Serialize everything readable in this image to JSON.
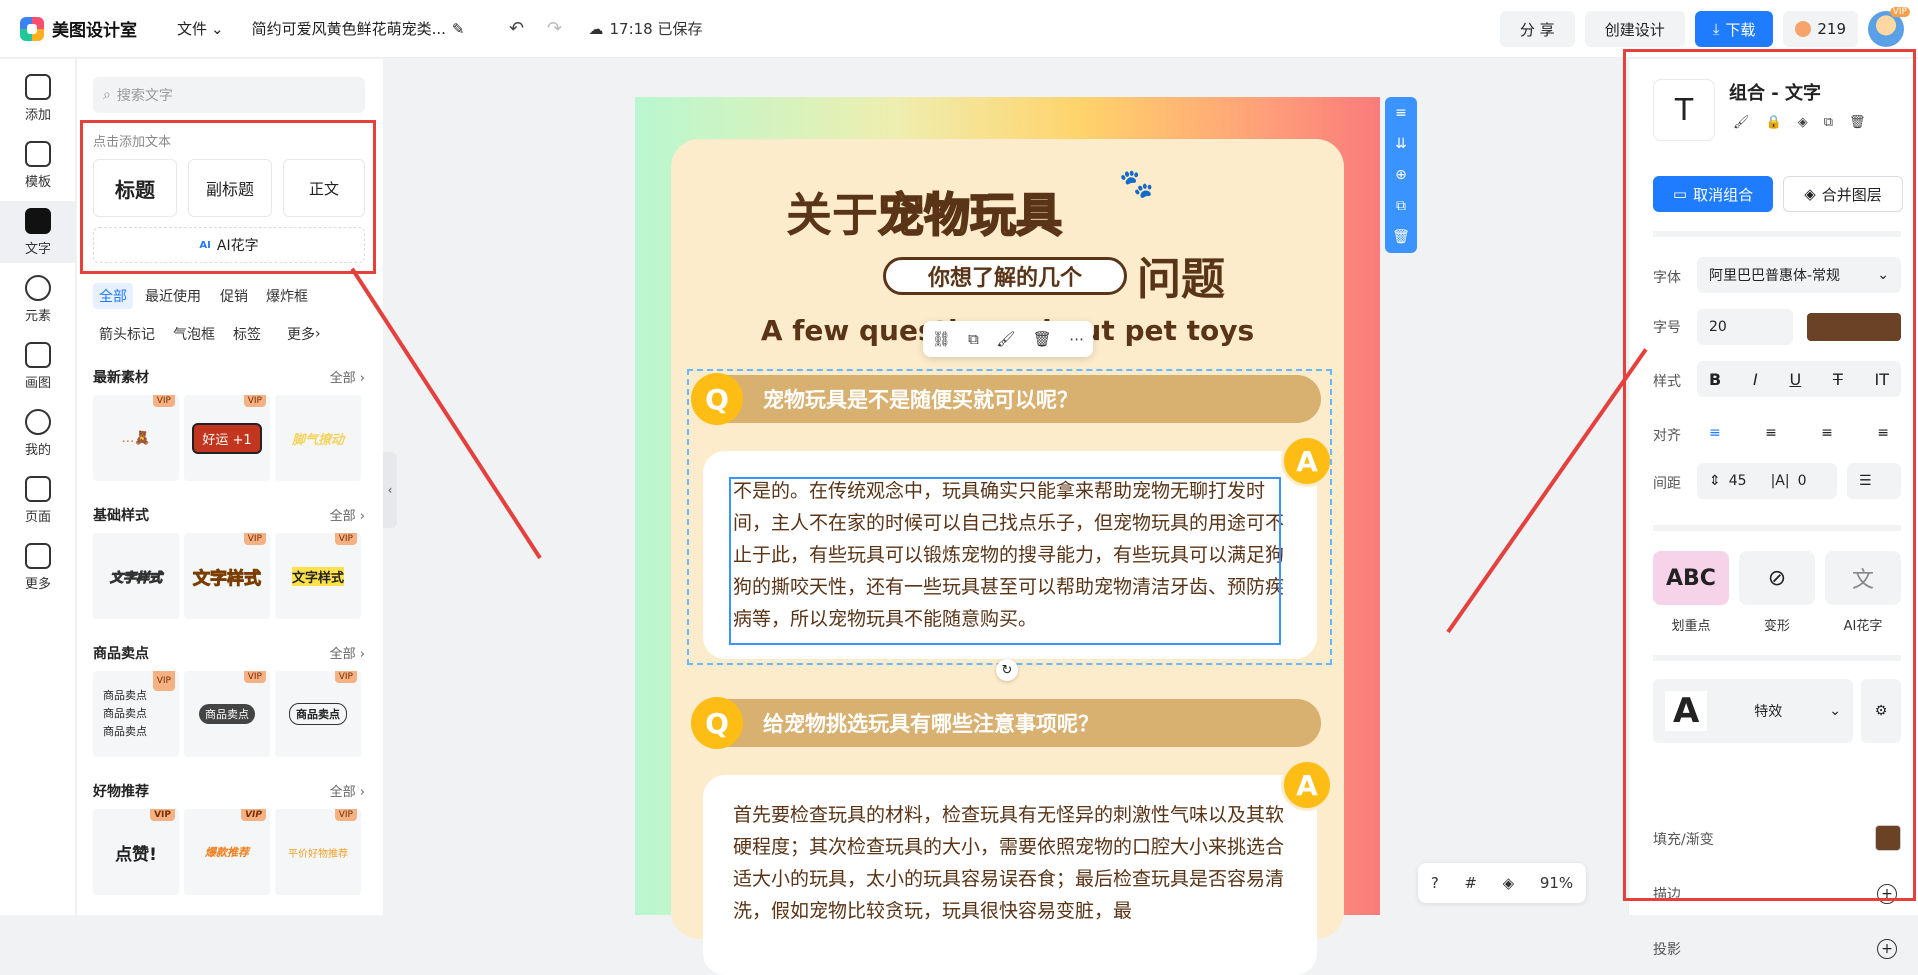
{
  "app": {
    "name": "美图设计室"
  },
  "topbar": {
    "file_menu": "文件",
    "doc_title": "简约可爱风黄色鲜花萌宠类...",
    "save_time": "17:18 已保存",
    "share": "分 享",
    "create": "创建设计",
    "download": "下载",
    "coins": "219",
    "vip": "VIP"
  },
  "rail": [
    {
      "label": "添加",
      "icon": "plus-icon"
    },
    {
      "label": "模板",
      "icon": "template-icon"
    },
    {
      "label": "文字",
      "icon": "text-icon"
    },
    {
      "label": "元素",
      "icon": "element-icon"
    },
    {
      "label": "画图",
      "icon": "draw-icon"
    },
    {
      "label": "我的",
      "icon": "user-icon"
    },
    {
      "label": "页面",
      "icon": "page-icon"
    },
    {
      "label": "更多",
      "icon": "more-icon"
    }
  ],
  "panel": {
    "search_placeholder": "搜索文字",
    "hint": "点击添加文本",
    "title_card": "标题",
    "subtitle_card": "副标题",
    "body_card": "正文",
    "ai_tag": "AI",
    "ai_card": "AI花字",
    "chips": [
      "全部",
      "最近使用",
      "促销",
      "爆炸框",
      "箭头标记",
      "气泡框",
      "标签",
      "更多"
    ],
    "sections": [
      {
        "title": "最新素材",
        "all": "全部",
        "tiles": [
          "",
          "好运 +1",
          "脚气撩动"
        ]
      },
      {
        "title": "基础样式",
        "all": "全部",
        "tiles": [
          "文字样式",
          "文字样式",
          "文字样式"
        ]
      },
      {
        "title": "商品卖点",
        "all": "全部",
        "tiles": [
          "商品卖点\n商品卖点\n商品卖点",
          "商品卖点",
          "商品卖点"
        ]
      },
      {
        "title": "好物推荐",
        "all": "全部",
        "tiles": [
          "点赞!",
          "爆款推荐",
          "平价好物推荐"
        ]
      }
    ],
    "vip": "VIP"
  },
  "canvas": {
    "title_pre": "关于",
    "title_hl": "宠物玩具",
    "sub_pill": "你想了解的几个",
    "sub_big": "问题",
    "en_title": "A few questions about pet toys",
    "q1": "宠物玩具是不是随便买就可以呢？",
    "a1": "不是的。在传统观念中，玩具确实只能拿来帮助宠物无聊打发时间，主人不在家的时候可以自己找点乐子，但宠物玩具的用途可不止于此，有些玩具可以锻炼宠物的搜寻能力，有些玩具可以满足狗狗的撕咬天性，还有一些玩具甚至可以帮助宠物清洁牙齿、预防疾病等，所以宠物玩具不能随意购买。",
    "q2": "给宠物挑选玩具有哪些注意事项呢？",
    "a2": "首先要检查玩具的材料，检查玩具有无怪异的刺激性气味以及其软硬程度；其次检查玩具的大小，需要依照宠物的口腔大小来挑选合适大小的玩具，太小的玩具容易误吞食；最后检查玩具是否容易清洗，假如宠物比较贪玩，玩具很快容易变脏，最",
    "q_letter": "Q",
    "a_letter": "A"
  },
  "zoom": "91%",
  "right": {
    "title": "组合 - 文字",
    "ungroup": "取消组合",
    "merge": "合并图层",
    "font_label": "字体",
    "font_value": "阿里巴巴普惠体-常规",
    "size_label": "字号",
    "size_value": "20",
    "style_label": "样式",
    "align_label": "对齐",
    "spacing_label": "间距",
    "line_spacing": "45",
    "letter_spacing": "0",
    "fx": [
      "划重点",
      "变形",
      "AI花字"
    ],
    "effect_label": "特效",
    "fill_label": "填充/渐变",
    "stroke_label": "描边",
    "shadow_label": "投影",
    "text_color": "#6b4226"
  }
}
